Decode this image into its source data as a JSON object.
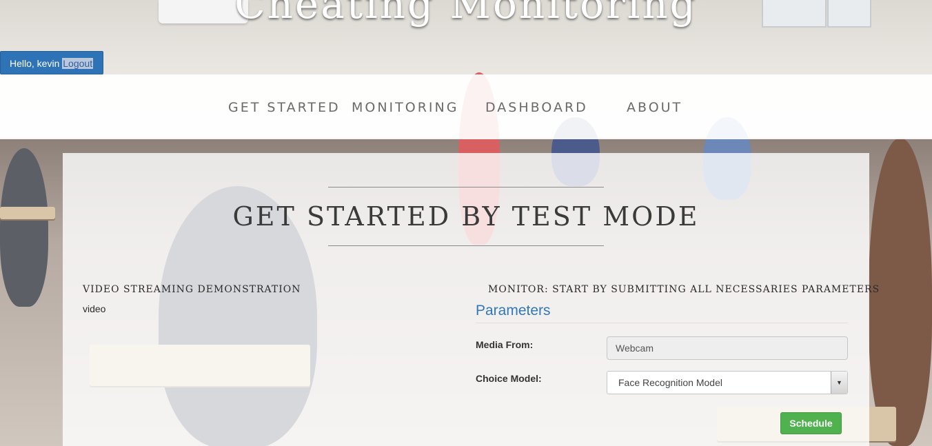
{
  "header": {
    "site_title": "Cheating Monitoring",
    "greeting": "Hello, kevin",
    "logout_label": "Logout"
  },
  "nav": {
    "items": [
      {
        "label": "GET STARTED"
      },
      {
        "label": "MONITORING"
      },
      {
        "label": "DASHBOARD"
      },
      {
        "label": "ABOUT"
      }
    ]
  },
  "main": {
    "heading": "GET STARTED BY TEST MODE",
    "video_section": {
      "title": "VIDEO STREAMING DEMONSTRATION",
      "placeholder": "video"
    },
    "monitor_section": {
      "title": "MONITOR: START BY SUBMITTING ALL NECESSARIES PARAMETERS",
      "legend": "Parameters",
      "media_label": "Media From:",
      "media_value": "Webcam",
      "model_label": "Choice Model:",
      "model_value": "Face Recognition Model",
      "schedule_label": "Schedule"
    }
  },
  "colors": {
    "primary_blue": "#2f73b7",
    "legend_blue": "#3277b8",
    "success_green": "#4fb24f"
  }
}
